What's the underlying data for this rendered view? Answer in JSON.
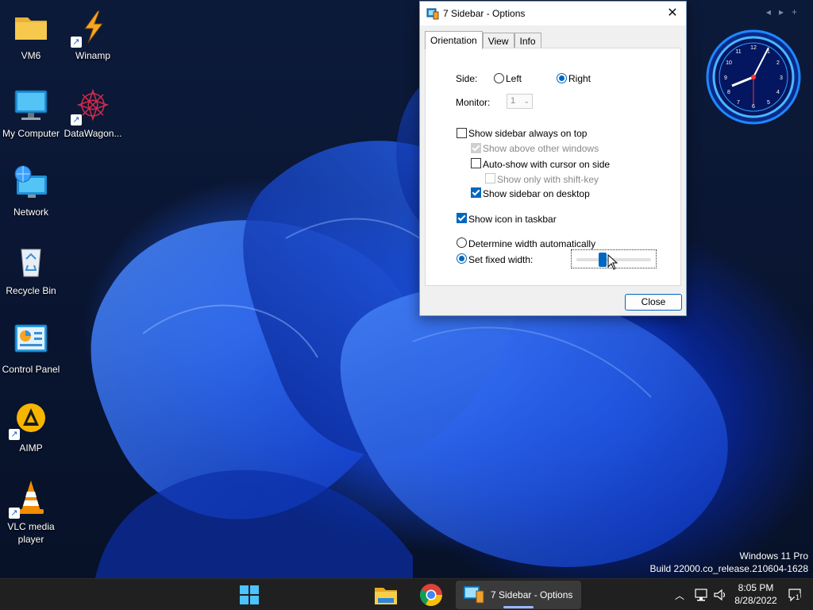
{
  "desktop": {
    "icons": [
      {
        "label": "VM6"
      },
      {
        "label": "Winamp"
      },
      {
        "label": "My Computer"
      },
      {
        "label": "DataWagon..."
      },
      {
        "label": "Network"
      },
      {
        "label": "Recycle Bin"
      },
      {
        "label": "Control Panel"
      },
      {
        "label": "AIMP"
      },
      {
        "label": "VLC media player"
      }
    ],
    "watermark": {
      "line1": "Windows 11 Pro",
      "line2": "Build 22000.co_release.210604-1628"
    }
  },
  "dialog": {
    "title": "7 Sidebar - Options",
    "tabs": [
      "Orientation",
      "View",
      "Info"
    ],
    "active_tab": "Orientation",
    "side_label": "Side:",
    "side_left": "Left",
    "side_right": "Right",
    "side_selected": "Right",
    "monitor_label": "Monitor:",
    "monitor_value": "1",
    "always_on_top": {
      "label": "Show sidebar always on top",
      "checked": false
    },
    "show_above": {
      "label": "Show above other windows",
      "checked": true,
      "disabled": true
    },
    "auto_show": {
      "label": "Auto-show with cursor on side",
      "checked": false
    },
    "shift_key": {
      "label": "Show only with shift-key",
      "checked": false,
      "disabled": true
    },
    "show_on_desktop": {
      "label": "Show sidebar on desktop",
      "checked": true
    },
    "show_taskbar_icon": {
      "label": "Show icon in taskbar",
      "checked": true
    },
    "width_auto": "Determine width automatically",
    "width_fixed": "Set fixed width:",
    "width_selected": "fixed",
    "width_slider_fraction": 0.33,
    "close_label": "Close"
  },
  "taskbar": {
    "window_label": "7 Sidebar - Options",
    "time": "8:05 PM",
    "date": "8/28/2022",
    "notification_count": "1"
  },
  "colors": {
    "accent": "#0067c0",
    "taskbar": "#202020"
  }
}
